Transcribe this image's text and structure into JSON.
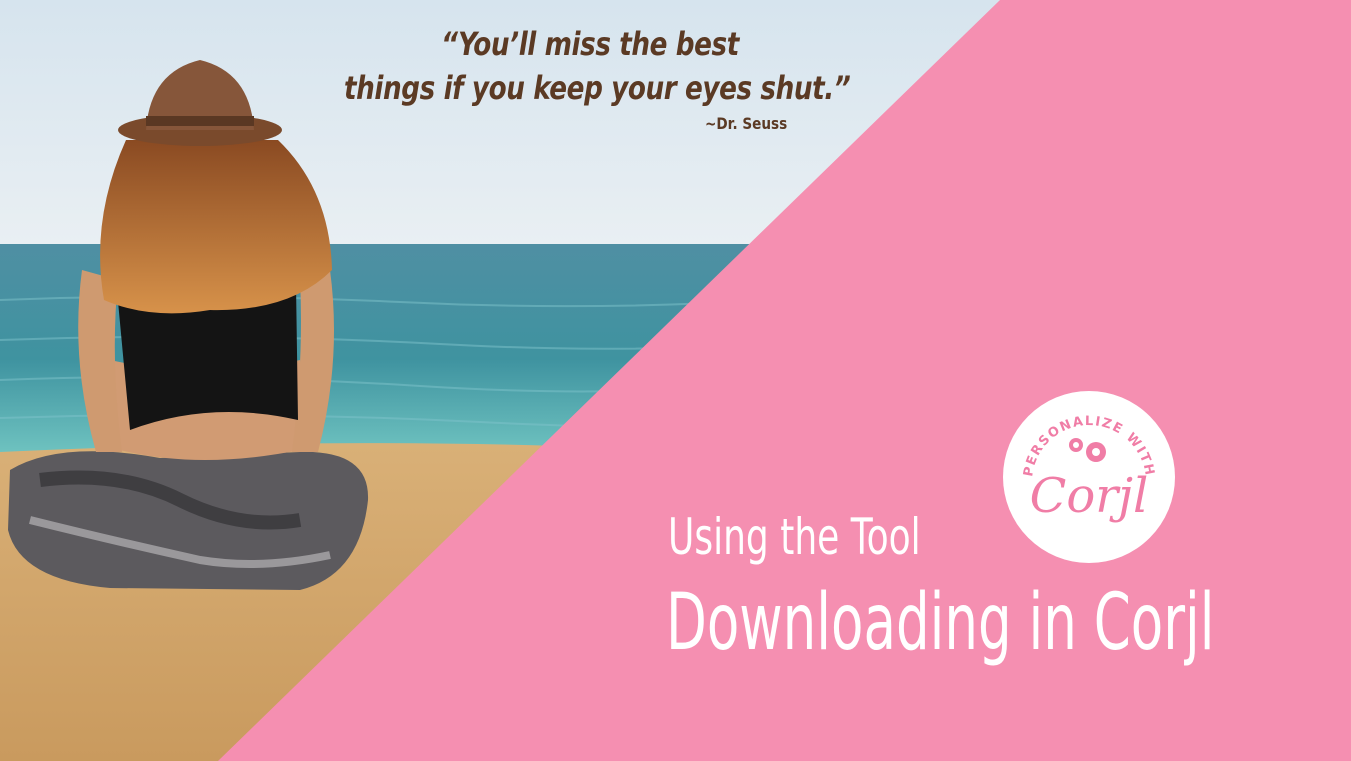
{
  "quote": {
    "lines": [
      "“You’ll miss the best",
      "things if you keep your eyes shut.”"
    ],
    "author": "~Dr. Seuss"
  },
  "headline": {
    "subtitle": "Using the Tool",
    "title": "Downloading in Corjl"
  },
  "badge": {
    "arc_text": "PERSONALIZE WITH",
    "brand": "Corjl"
  },
  "colors": {
    "pink": "#f58fb1",
    "quote_brown": "#5b3a24",
    "badge_pink": "#f07da6",
    "white": "#ffffff"
  }
}
